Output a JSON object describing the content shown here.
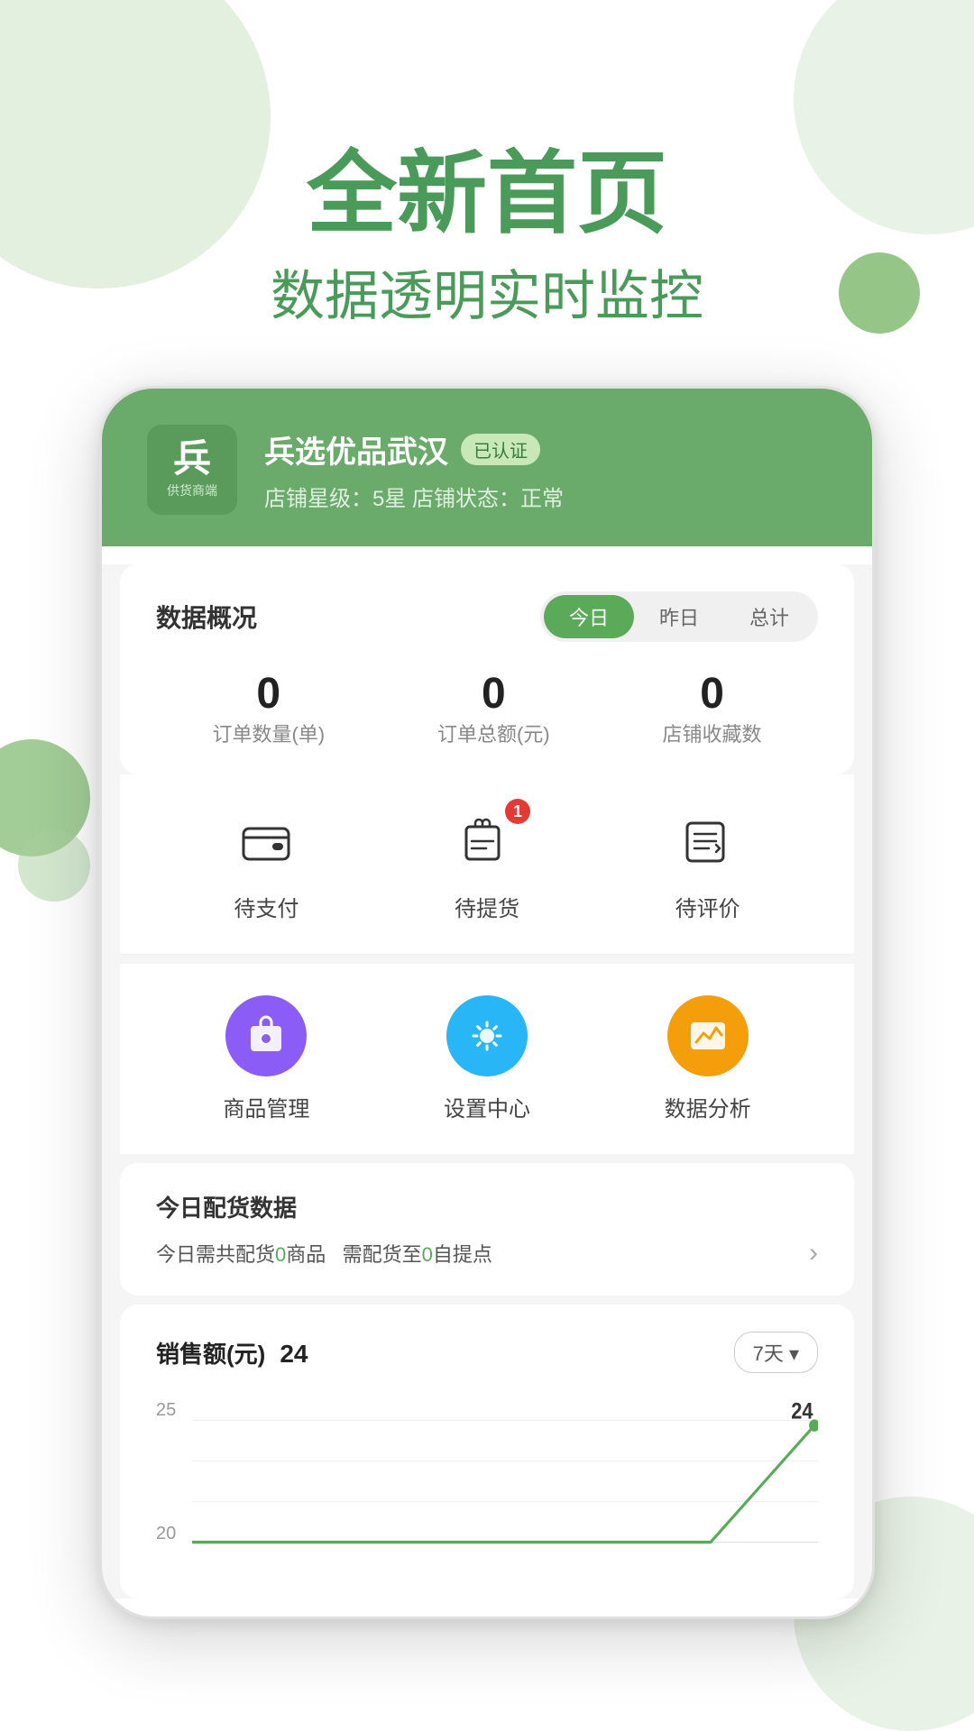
{
  "hero": {
    "title": "全新首页",
    "subtitle": "数据透明实时监控"
  },
  "app": {
    "logo_char": "兵",
    "logo_sub": "供货商端",
    "store_name": "兵选优品武汉",
    "verified_label": "已认证",
    "store_meta": "店铺星级：5星   店铺状态：正常"
  },
  "data_overview": {
    "title": "数据概况",
    "tabs": [
      "今日",
      "昨日",
      "总计"
    ],
    "active_tab": 0,
    "stats": [
      {
        "value": "0",
        "label": "订单数量(单)"
      },
      {
        "value": "0",
        "label": "订单总额(元)"
      },
      {
        "value": "0",
        "label": "店铺收藏数"
      }
    ]
  },
  "quick_actions": [
    {
      "id": "pending_payment",
      "label": "待支付",
      "badge": null
    },
    {
      "id": "pending_pickup",
      "label": "待提货",
      "badge": "1"
    },
    {
      "id": "pending_review",
      "label": "待评价",
      "badge": null
    }
  ],
  "features": [
    {
      "id": "product_mgmt",
      "label": "商品管理",
      "color": "purple"
    },
    {
      "id": "settings",
      "label": "设置中心",
      "color": "blue"
    },
    {
      "id": "data_analysis",
      "label": "数据分析",
      "color": "orange"
    }
  ],
  "delivery": {
    "title": "今日配货数据",
    "info_text": "今日需共配货",
    "goods_count": "0",
    "goods_unit": "商品",
    "pickup_text": "需配货至",
    "pickup_count": "0",
    "pickup_suffix": "自提点"
  },
  "sales": {
    "title": "销售额(元)",
    "value": "24",
    "days_label": "7天 ▾",
    "chart": {
      "y_labels": [
        "25",
        "20"
      ],
      "data_points": [
        0,
        0,
        0,
        0,
        0,
        0,
        24
      ],
      "peak_value": "24"
    }
  }
}
